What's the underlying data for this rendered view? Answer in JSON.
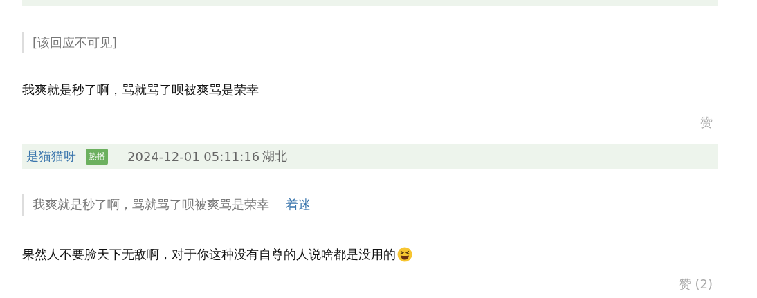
{
  "comments": [
    {
      "quote": {
        "text": "[该回应不可见]"
      },
      "body": "我爽就是秒了啊，骂就骂了呗被爽骂是荣幸",
      "like": "赞"
    },
    {
      "author": "是猫猫呀",
      "badge": "热播",
      "datetime": "2024-12-01 05:11:16",
      "location": "湖北",
      "quote": {
        "text": "我爽就是秒了啊，骂就骂了呗被爽骂是荣幸",
        "author": "着迷"
      },
      "body": "果然人不要脸天下无敌啊，对于你这种没有自尊的人说啥都是没用的",
      "emoji": true,
      "like": "赞 (2)"
    }
  ]
}
